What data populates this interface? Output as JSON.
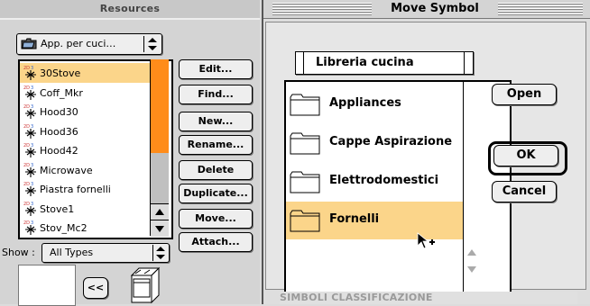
{
  "resources": {
    "title": "Resources",
    "library_popup": "App. per cuci…",
    "symbols": [
      "30Stove",
      "Coff_Mkr",
      "Hood30",
      "Hood36",
      "Hood42",
      "Microwave",
      "Piastra fornelli",
      "Stove1",
      "Stov_Mc2"
    ],
    "selected_symbol_index": 0,
    "buttons": [
      "Edit...",
      "Find...",
      "New...",
      "Rename...",
      "Delete",
      "Duplicate...",
      "Move...",
      "Attach..."
    ],
    "show_label": "Show :",
    "show_value": "All Types",
    "collapse_label": "<<"
  },
  "dialog": {
    "title": "Move Symbol",
    "path": "Libreria cucina",
    "folders": [
      "Appliances",
      "Cappe Aspirazione",
      "Elettrodomestici",
      "Fornelli"
    ],
    "selected_folder_index": 3,
    "open_label": "Open",
    "ok_label": "OK",
    "cancel_label": "Cancel"
  },
  "background": {
    "caption": "SIMBOLI CLASSIFICAZIONE"
  },
  "colors": {
    "selection": "#fbd58a",
    "scroll_accent": "#ff8c1a"
  }
}
